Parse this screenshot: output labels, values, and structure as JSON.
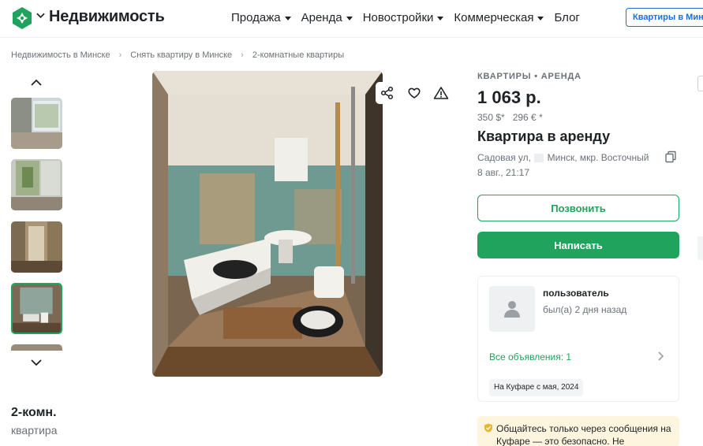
{
  "header": {
    "brand": "Недвижимость",
    "nav": [
      {
        "label": "Продажа",
        "has_caret": true
      },
      {
        "label": "Аренда",
        "has_caret": true
      },
      {
        "label": "Новостройки",
        "has_caret": true
      },
      {
        "label": "Коммерческая",
        "has_caret": true
      },
      {
        "label": "Блог",
        "has_caret": false
      }
    ],
    "cta_label": "Квартиры в Мин"
  },
  "breadcrumb": [
    "Недвижимость в Минске",
    "Снять квартиру в Минске",
    "2-комнатные квартиры"
  ],
  "gallery": {
    "thumb_count_visible": 5,
    "active_thumb_index": 3
  },
  "listing": {
    "rooms_title": "2-комн.",
    "rooms_sub": "квартира",
    "category": "КВАРТИРЫ • АРЕНДА",
    "price": "1 063 р.",
    "price_alt": "350 $*   296 € *",
    "title": "Квартира в аренду",
    "address_street": "Садовая ул,",
    "address_city": "Минск, мкр. Восточный",
    "date": "8 авг., 21:17"
  },
  "actions": {
    "call_label": "Позвонить",
    "write_label": "Написать"
  },
  "seller": {
    "name": "пользователь",
    "last_seen": "был(а) 2 дня назад",
    "all_ads": "Все объявления: 1",
    "since": "На Куфаре с мая, 2024"
  },
  "safety_text": "Общайтесь только через сообщения на Куфаре — это безопасно. Не",
  "colors": {
    "accent_green": "#1fa35d",
    "link_blue": "#1c6fd6",
    "safety_bg": "#fdf5de"
  },
  "icons": [
    "logo-icon",
    "chevron-down-icon",
    "chevron-up-icon",
    "share-icon",
    "heart-icon",
    "warning-icon",
    "copy-icon",
    "user-icon",
    "chevron-right-icon",
    "shield-icon"
  ]
}
